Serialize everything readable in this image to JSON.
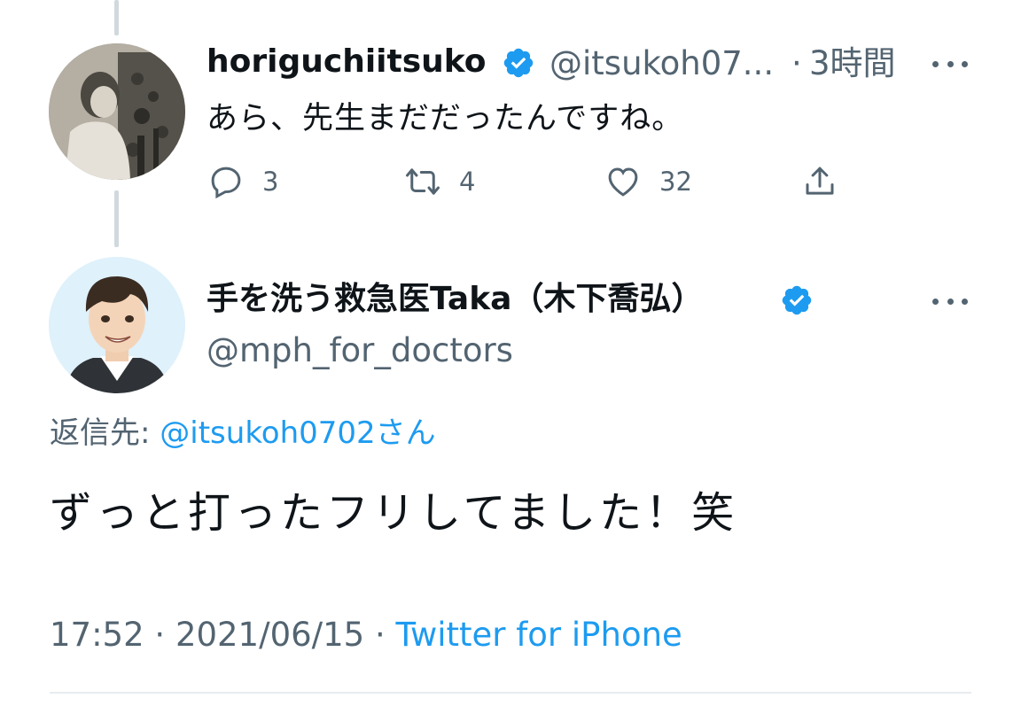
{
  "first_tweet": {
    "display_name": "horiguchiitsuko",
    "handle_truncated": "@itsukoh07...",
    "separator": "·",
    "time_ago": "3時間",
    "text": "あら、先生まだだったんですね。",
    "reply_count": "3",
    "retweet_count": "4",
    "like_count": "32"
  },
  "main_tweet": {
    "display_name": "手を洗う救急医Taka（木下喬弘）",
    "handle": "@mph_for_doctors",
    "reply_prefix": "返信先:",
    "reply_mention": "@itsukoh0702さん",
    "text": "ずっと打ったフリしてました！笑",
    "time": "17:52",
    "sep1": "·",
    "date": "2021/06/15",
    "sep2": "·",
    "source": "Twitter for iPhone"
  },
  "colors": {
    "verified": "#1d9bf0",
    "link": "#1d9bf0",
    "secondary_text": "#536471",
    "thread_line": "#cfd9de"
  },
  "icons": {
    "reply": "reply-icon",
    "retweet": "retweet-icon",
    "like": "heart-icon",
    "share": "share-icon",
    "more": "more-icon",
    "verified": "verified-badge-icon"
  }
}
